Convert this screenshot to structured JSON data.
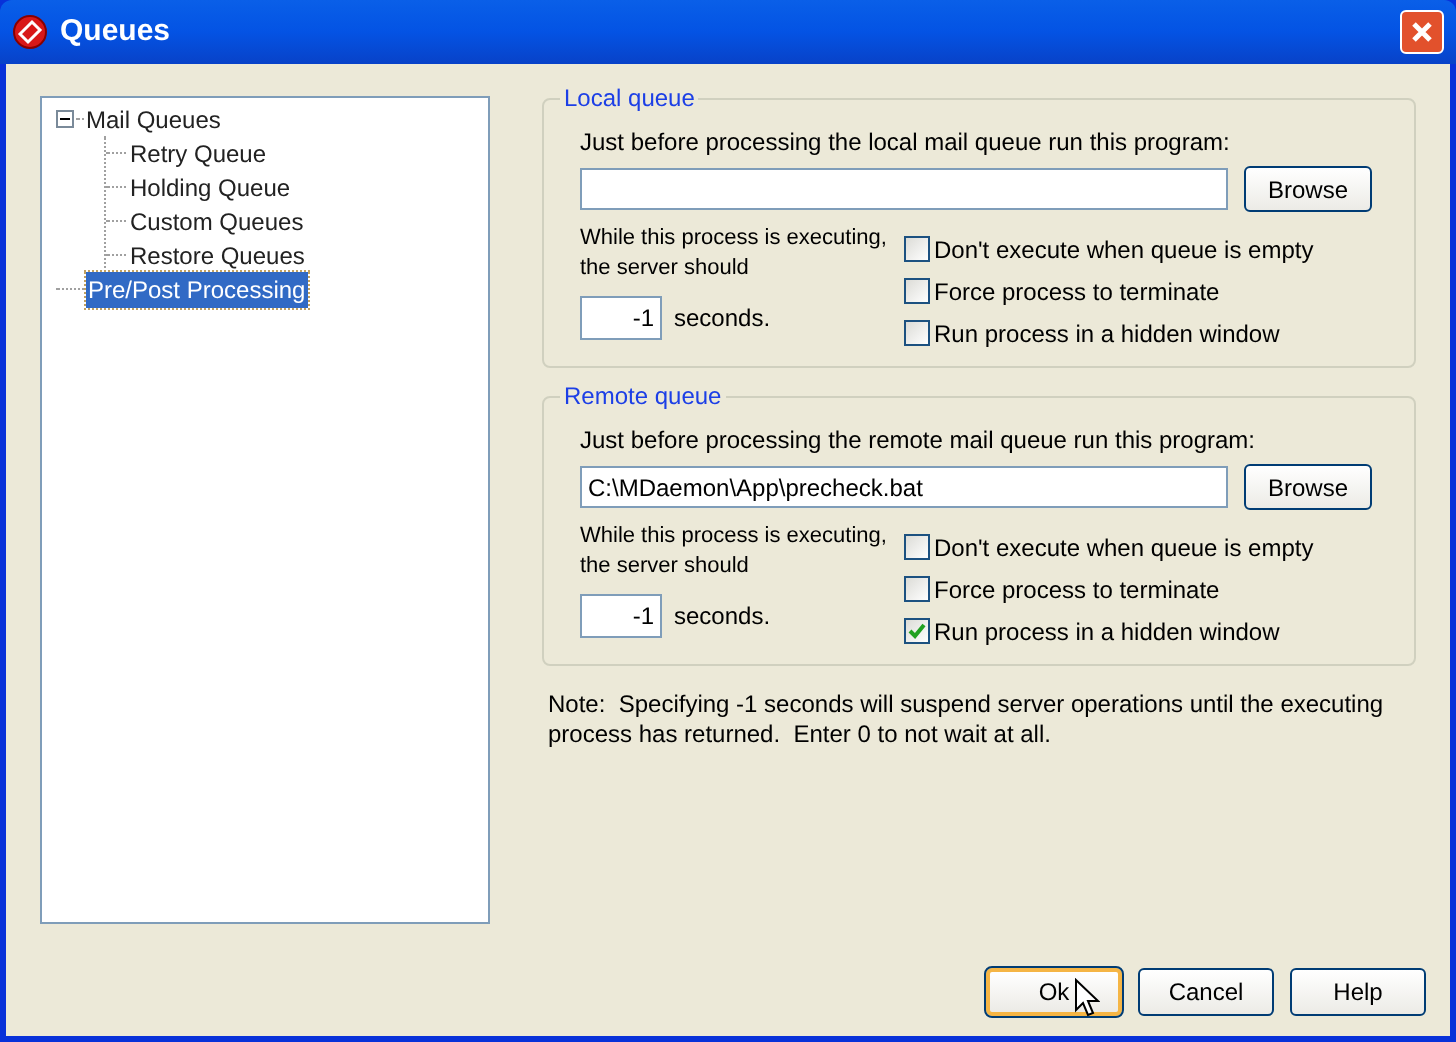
{
  "window": {
    "title": "Queues"
  },
  "tree": [
    {
      "label": "Mail Queues",
      "expanded": true,
      "selected": false,
      "children": [
        {
          "label": "Retry Queue",
          "selected": false
        },
        {
          "label": "Holding Queue",
          "selected": false
        },
        {
          "label": "Custom Queues",
          "selected": false
        },
        {
          "label": "Restore Queues",
          "selected": false
        }
      ]
    },
    {
      "label": "Pre/Post Processing",
      "selected": true
    }
  ],
  "groups": [
    {
      "title": "Local queue",
      "prompt": "Just before processing the local mail queue run this program:",
      "browse": "Browse",
      "wait_label": "While this process is executing, the server should",
      "seconds": "-1",
      "seconds_label": "seconds.",
      "options": [
        {
          "label": "Don't execute when queue is empty",
          "checked": false
        },
        {
          "label": "Force process to terminate",
          "checked": false
        },
        {
          "label": "Run process in a hidden window",
          "checked": false
        }
      ]
    },
    {
      "title": "Remote queue",
      "prompt": "Just before processing the remote mail queue run this program:",
      "program": "C:\\MDaemon\\App\\precheck.bat",
      "browse": "Browse",
      "wait_label": "While this process is executing, the server should",
      "seconds": "-1",
      "seconds_label": "seconds.",
      "options": [
        {
          "label": "Don't execute when queue is empty",
          "checked": false
        },
        {
          "label": "Force process to terminate",
          "checked": false
        },
        {
          "label": "Run process in a hidden window",
          "checked": true
        }
      ]
    }
  ],
  "note": "Note:  Specifying -1 seconds will suspend server operations until the executing process has returned.  Enter 0 to not wait at all.",
  "buttons": [
    {
      "label": "Ok",
      "default": true
    },
    {
      "label": "Cancel",
      "default": false
    },
    {
      "label": "Help",
      "default": false
    }
  ]
}
